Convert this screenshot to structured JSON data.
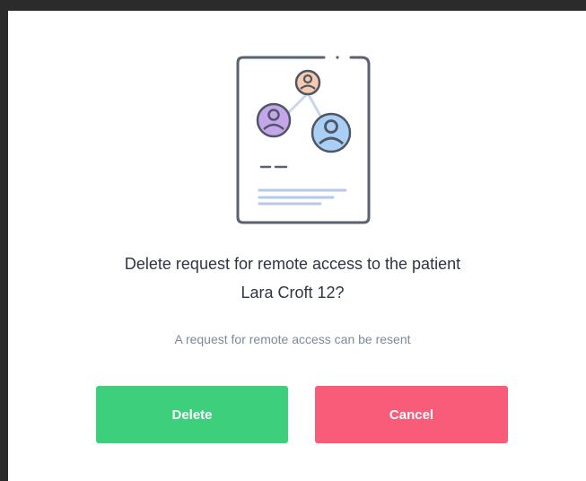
{
  "dialog": {
    "title_line1": "Delete request for remote access to the patient",
    "title_line2": "Lara Croft 12?",
    "subtitle": "A request for remote access can be resent",
    "delete_label": "Delete",
    "cancel_label": "Cancel",
    "illustration_icon": "patient-network-document-icon"
  },
  "colors": {
    "delete_button": "#3ecf7c",
    "cancel_button": "#f85c78",
    "title_text": "#2f3542",
    "subtitle_text": "#7b8a9c"
  }
}
